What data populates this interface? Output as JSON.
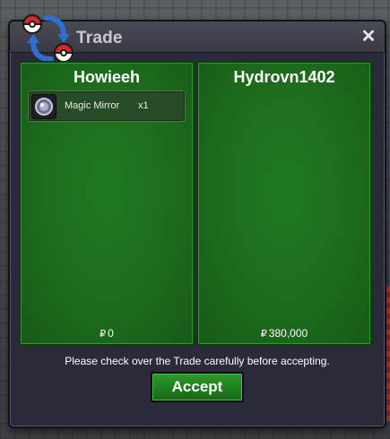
{
  "window": {
    "title": "Trade",
    "close_label": "✕"
  },
  "trade": {
    "left": {
      "player": "Howieeh",
      "items": [
        {
          "name": "Magic Mirror",
          "qty": "x1",
          "icon": "magic-mirror-icon"
        }
      ],
      "currency_symbol": "₽",
      "money": "0"
    },
    "right": {
      "player": "Hydrovn1402",
      "currency_symbol": "₽",
      "money": "380,000"
    }
  },
  "notice": "Please check over the Trade carefully before accepting.",
  "accept_label": "Accept",
  "colors": {
    "panel_green": "#1d6b1d",
    "button_green": "#1e7e1e",
    "window_bg": "#2b2a3a"
  }
}
